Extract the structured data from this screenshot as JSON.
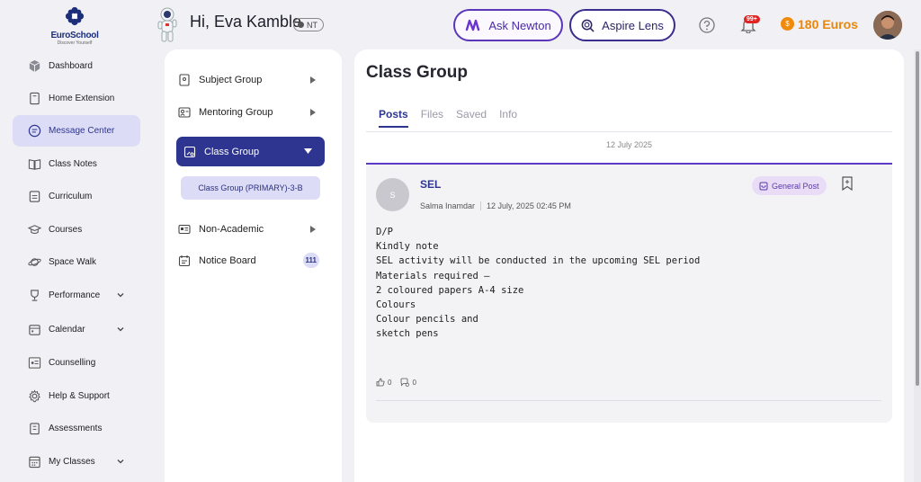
{
  "logo": {
    "name": "EuroSchool",
    "tagline": "Discover Yourself"
  },
  "header": {
    "greeting": "Hi, Eva Kamble",
    "badge": "NT",
    "ask_newton": "Ask Newton",
    "aspire_lens": "Aspire Lens",
    "notification_count": "99+",
    "currency": "180 Euros",
    "coin_symbol": "$"
  },
  "sidebar": {
    "items": [
      {
        "label": "Dashboard",
        "icon": "cube-icon"
      },
      {
        "label": "Home Extension",
        "icon": "book-icon"
      },
      {
        "label": "Message Center",
        "icon": "message-icon",
        "active": true
      },
      {
        "label": "Class Notes",
        "icon": "open-book-icon"
      },
      {
        "label": "Curriculum",
        "icon": "document-icon"
      },
      {
        "label": "Courses",
        "icon": "graduation-cap-icon"
      },
      {
        "label": "Space Walk",
        "icon": "planet-icon"
      },
      {
        "label": "Performance",
        "icon": "trophy-icon",
        "expandable": true
      },
      {
        "label": "Calendar",
        "icon": "calendar-icon",
        "expandable": true
      },
      {
        "label": "Counselling",
        "icon": "presentation-icon"
      },
      {
        "label": "Help & Support",
        "icon": "gear-icon"
      },
      {
        "label": "Assessments",
        "icon": "clipboard-icon"
      },
      {
        "label": "My Classes",
        "icon": "calendar-grid-icon",
        "expandable": true
      }
    ]
  },
  "groups": {
    "subject": "Subject Group",
    "mentoring": "Mentoring Group",
    "class": "Class Group",
    "class_child": "Class Group (PRIMARY)-3-B",
    "non_academic": "Non-Academic",
    "notice_board": "Notice Board",
    "notice_count": "111"
  },
  "main": {
    "title": "Class Group",
    "tabs": [
      "Posts",
      "Files",
      "Saved",
      "Info"
    ],
    "active_tab": "Posts",
    "date": "12 July 2025"
  },
  "post": {
    "avatar_initial": "S",
    "title": "SEL",
    "author": "Salma Inamdar",
    "timestamp": "12 July, 2025 02:45 PM",
    "tag": "General Post",
    "body": "D/P\nKindly note\nSEL activity will be conducted in the upcoming SEL period\nMaterials required –\n2 coloured papers A-4 size\nColours\nColour pencils and\nsketch pens",
    "likes": "0",
    "comments": "0"
  },
  "colors": {
    "primary": "#2d3590",
    "accent": "#5e3ac8",
    "coin": "#f08a0c",
    "active_nav": "#dcdcf7"
  }
}
